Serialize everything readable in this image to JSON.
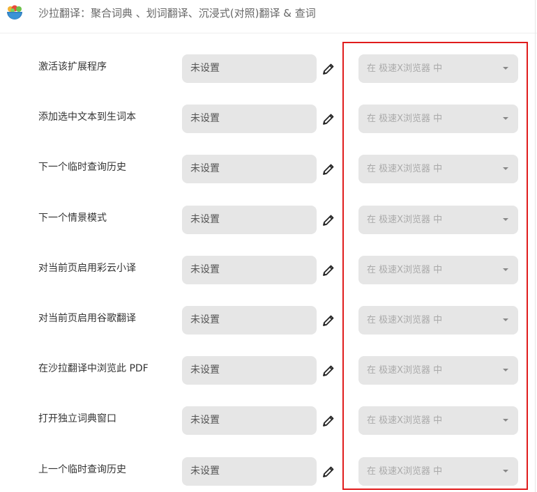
{
  "header": {
    "title": "沙拉翻译：聚合词典 、划词翻译、沉浸式(对照)翻译 & 查词",
    "logo_icon": "salad-bowl-logo-icon"
  },
  "colors": {
    "accent_highlight": "#e01b1b",
    "field_bg": "#e6e6e6",
    "label_text": "#333333",
    "muted_text": "#aaaaaa"
  },
  "shortcuts": [
    {
      "label": "激活该扩展程序",
      "value": "未设置",
      "scope": "在 极速X浏览器 中"
    },
    {
      "label": "添加选中文本到生词本",
      "value": "未设置",
      "scope": "在 极速X浏览器 中"
    },
    {
      "label": "下一个临时查询历史",
      "value": "未设置",
      "scope": "在 极速X浏览器 中"
    },
    {
      "label": "下一个情景模式",
      "value": "未设置",
      "scope": "在 极速X浏览器 中"
    },
    {
      "label": "对当前页启用彩云小译",
      "value": "未设置",
      "scope": "在 极速X浏览器 中"
    },
    {
      "label": "对当前页启用谷歌翻译",
      "value": "未设置",
      "scope": "在 极速X浏览器 中"
    },
    {
      "label": "在沙拉翻译中浏览此 PDF",
      "value": "未设置",
      "scope": "在 极速X浏览器 中"
    },
    {
      "label": "打开独立词典窗口",
      "value": "未设置",
      "scope": "在 极速X浏览器 中"
    },
    {
      "label": "上一个临时查询历史",
      "value": "未设置",
      "scope": "在 极速X浏览器 中"
    }
  ]
}
